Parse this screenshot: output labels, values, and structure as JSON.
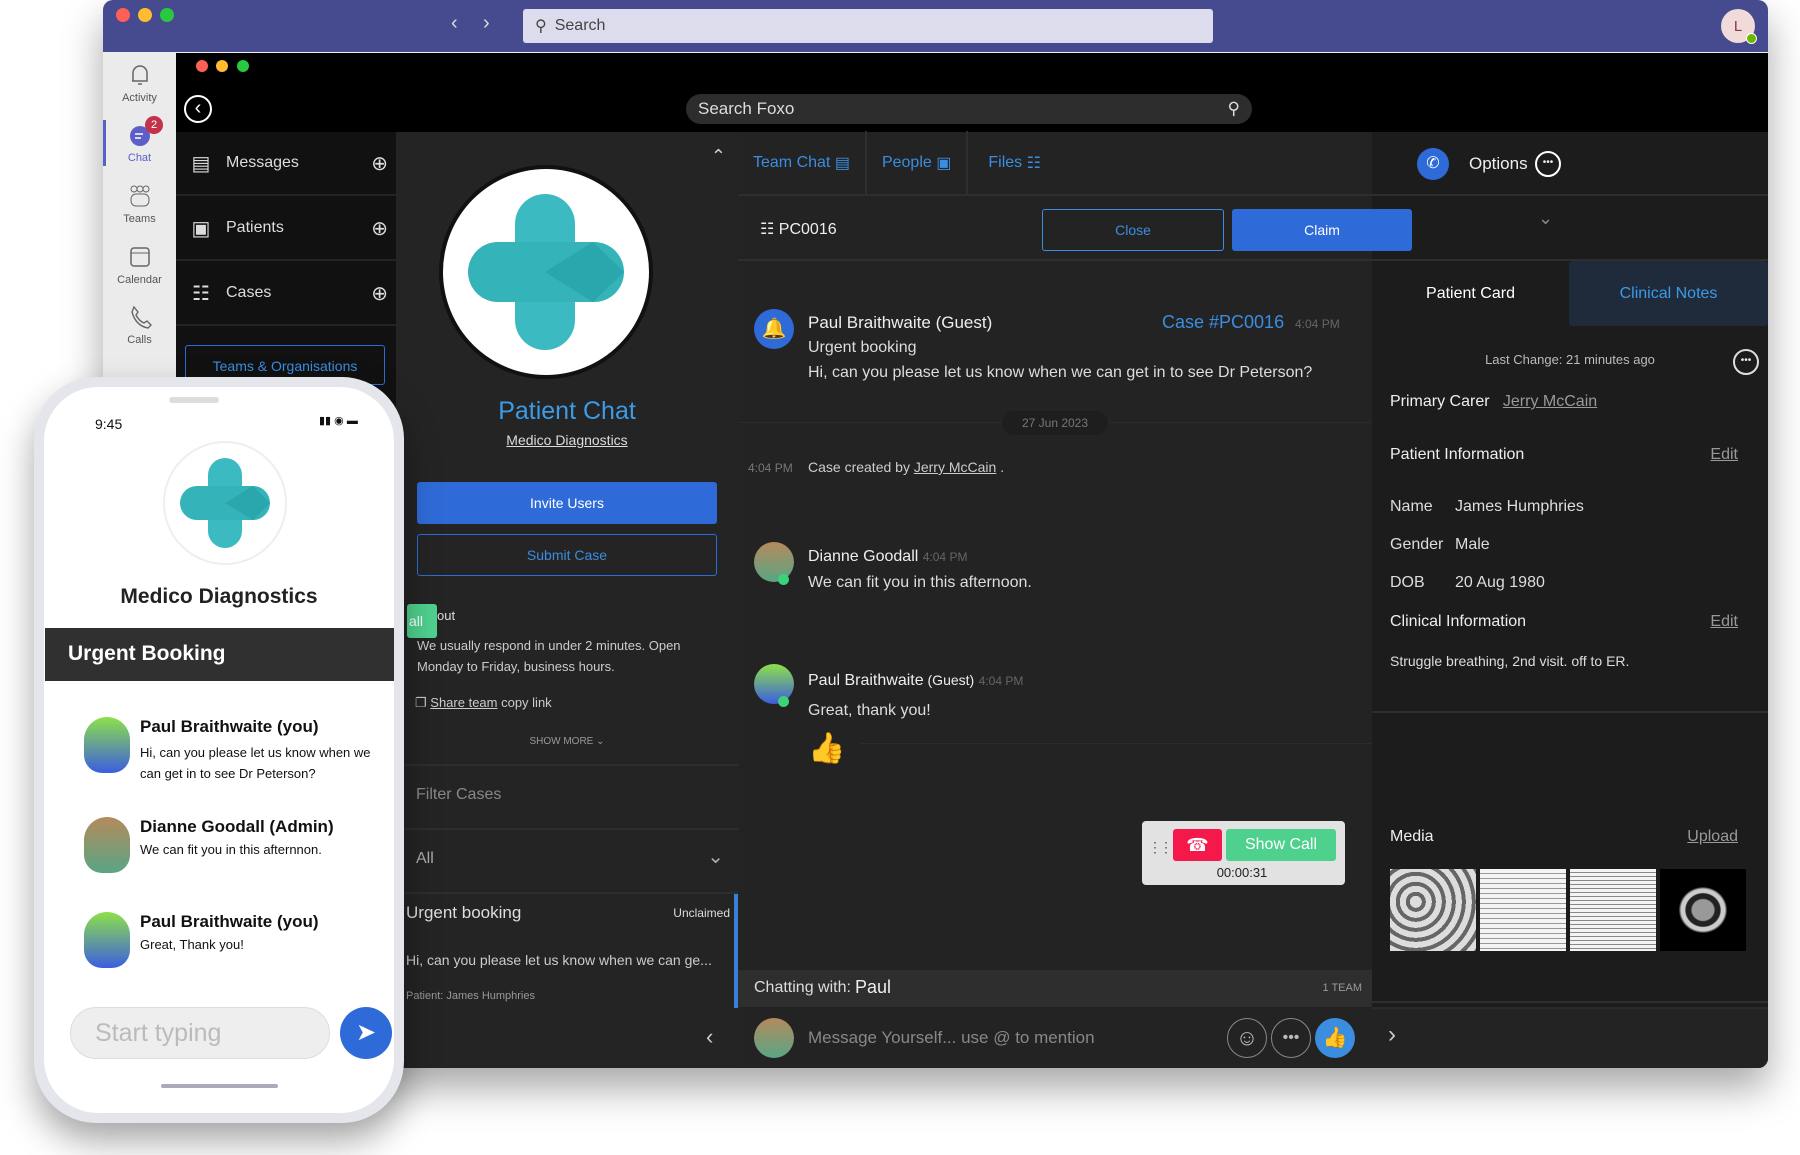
{
  "teams": {
    "search_placeholder": "Search",
    "avatar_initial": "L",
    "rail": [
      {
        "label": "Activity",
        "icon": "bell-icon"
      },
      {
        "label": "Chat",
        "icon": "chat-icon",
        "badge": "2",
        "active": true
      },
      {
        "label": "Teams",
        "icon": "teams-icon"
      },
      {
        "label": "Calendar",
        "icon": "calendar-icon"
      },
      {
        "label": "Calls",
        "icon": "phone-icon"
      }
    ]
  },
  "foxo": {
    "search_placeholder": "Search Foxo",
    "nav": [
      {
        "label": "Messages",
        "icon": "messages-icon"
      },
      {
        "label": "Patients",
        "icon": "patients-icon"
      },
      {
        "label": "Cases",
        "icon": "cases-icon"
      }
    ],
    "teams_orgs_button": "Teams & Organisations",
    "team": {
      "name": "Patient Chat",
      "org": "Medico Diagnostics",
      "invite_button": "Invite Users",
      "submit_button": "Submit Case",
      "call_tab_fragment": "all",
      "about_fragment": "out",
      "about_text": "We usually respond in under 2 minutes. Open Monday to Friday, business hours.",
      "share_link": "Share team",
      "share_suffix": " copy link",
      "show_more": "SHOW MORE"
    },
    "filter_placeholder": "Filter Cases",
    "filter_select": "All",
    "case_item": {
      "title": "Urgent booking",
      "status": "Unclaimed",
      "preview": "Hi, can you please let us know when we can ge...",
      "patient": "Patient: James Humphries"
    },
    "tabs": [
      {
        "label": "Team Chat"
      },
      {
        "label": "People"
      },
      {
        "label": "Files"
      }
    ],
    "options_label": "Options",
    "case_id": "PC0016",
    "close_button": "Close",
    "claim_button": "Claim",
    "messages": [
      {
        "name": "Paul Braithwaite (Guest)",
        "case_link": "Case #PC0016",
        "time": "4:04 PM",
        "subject": "Urgent booking",
        "text": "Hi, can you please let us know when we can get in to see Dr Peterson?"
      },
      {
        "date": "27 Jun 2023"
      },
      {
        "time": "4:04 PM",
        "text": "Case created by ",
        "link": "Jerry McCain",
        "suffix": " ."
      },
      {
        "name": "Dianne Goodall",
        "time": "4:04 PM",
        "text": "We can fit you in this afternoon."
      },
      {
        "name": "Paul Braithwaite",
        "name_suffix": " (Guest)",
        "time": "4:04 PM",
        "text": "Great, thank you!"
      }
    ],
    "call": {
      "show_call": "Show Call",
      "timer": "00:00:31"
    },
    "chatting_with_label": "Chatting with:",
    "chatting_with_name": "Paul",
    "team_count": "1 TEAM",
    "composer_placeholder": "Message Yourself... use @ to mention",
    "colors": {
      "accent": "#2f6bd8",
      "link": "#3b8de0",
      "call_green": "#4fd18e",
      "hangup_red": "#f5184a"
    }
  },
  "patient_panel": {
    "tabs": [
      "Patient Card",
      "Clinical Notes"
    ],
    "last_change": "Last Change: 21 minutes ago",
    "primary_carer_label": "Primary Carer",
    "primary_carer": "Jerry McCain",
    "patient_info_label": "Patient Information",
    "edit": "Edit",
    "fields": [
      {
        "k": "Name",
        "v": "James Humphries"
      },
      {
        "k": "Gender",
        "v": "Male"
      },
      {
        "k": "DOB",
        "v": "20 Aug 1980"
      }
    ],
    "clinical_label": "Clinical Information",
    "clinical_text": "Struggle breathing, 2nd visit. off to ER.",
    "media_label": "Media",
    "upload": "Upload"
  },
  "phone": {
    "time": "9:45",
    "org": "Medico Diagnostics",
    "title": "Urgent Booking",
    "messages": [
      {
        "name": "Paul Braithwaite (you)",
        "text": "Hi, can you please let us know when we can get in to see Dr Peterson?"
      },
      {
        "name": "Dianne Goodall (Admin)",
        "text": "We can fit you in this afternnon."
      },
      {
        "name": "Paul Braithwaite (you)",
        "text": "Great, Thank you!"
      }
    ],
    "input_placeholder": "Start typing"
  }
}
